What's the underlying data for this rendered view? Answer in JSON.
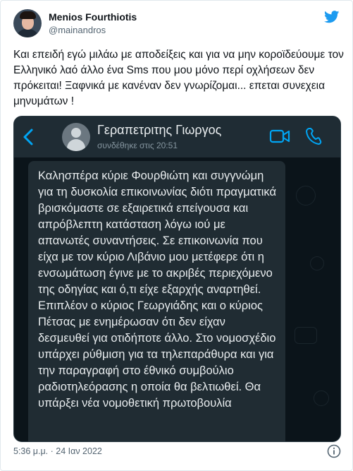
{
  "author": {
    "name": "Menios Fourthiotis",
    "handle": "@mainandros"
  },
  "tweet": {
    "text": "Και επειδή εγώ μιλάω με αποδείξεις και για να μην κοροϊδεύουμε τον Ελληνικό λαό άλλο ένα Sms που μου μόνο περί οχλήσεων δεν πρόκειται! Ξαφνικά με κανέναν δεν γνωρίζομαι... επεται συνεχεια μηνυμάτων !",
    "timestamp": "5:36 μ.μ. · 24 Ιαν 2022"
  },
  "chat": {
    "contact_name": "Γεραπετριτης Γιωργος",
    "contact_status": "συνδέθηκε στις 20:51",
    "message": "Καλησπέρα κύριε Φουρθιώτη και συγγνώμη για τη δυσκολία επικοινωνίας διότι πραγματικά βρισκόμαστε σε εξαιρετικά επείγουσα και απρόβλεπτη κατάσταση λόγω ιού με απανωτές συναντήσεις. Σε επικοινωνία που είχα  με τον κύριο Λιβάνιο μου μετέφερε ότι η ενσωμάτωση έγινε με το ακριβές περιεχόμενο της οδηγίας και ό,τι είχε εξαρχής αναρτηθεί. Επιπλέον ο κύριος Γεωργιάδης και ο κύριος Πέτσας με ενημέρωσαν ότι δεν είχαν δεσμευθεί για οτιδήποτε άλλο. Στο νομοσχέδιο υπάρχει ρύθμιση για τα τηλεπαράθυρα και για την παραγραφή στο έθνικό συμβούλιο ραδιοτηλεόρασης η οποία θα βελτιωθεί. Θα υπάρξει νέα νομοθετική πρωτοβουλία"
  },
  "colors": {
    "twitter_blue": "#1d9bf0",
    "whatsapp_accent": "#00a5f4",
    "chat_bg": "#0b141a",
    "bubble_bg": "#202c33"
  },
  "icons": {
    "brand": "twitter-bird-icon",
    "back": "chevron-left-icon",
    "video": "video-camera-icon",
    "phone": "phone-icon",
    "info": "info-icon"
  }
}
